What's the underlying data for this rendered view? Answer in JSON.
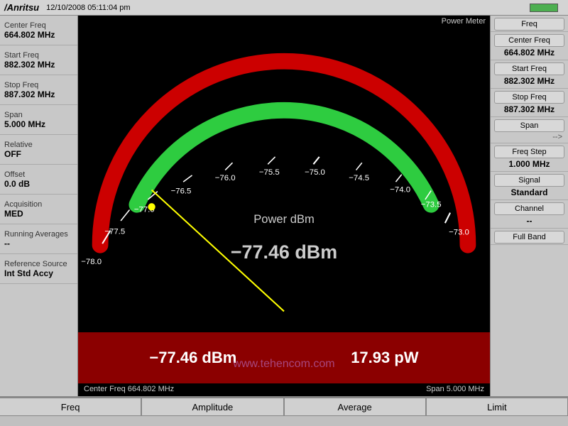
{
  "topbar": {
    "logo": "/Anritsu",
    "datetime": "12/10/2008  05:11:04 pm"
  },
  "left": {
    "items": [
      {
        "label": "Center Freq",
        "value": "664.802 MHz"
      },
      {
        "label": "Start Freq",
        "value": "882.302 MHz"
      },
      {
        "label": "Stop Freq",
        "value": "887.302 MHz"
      },
      {
        "label": "Span",
        "value": "5.000 MHz"
      },
      {
        "label": "Relative",
        "value": "OFF"
      },
      {
        "label": "Offset",
        "value": "0.0 dB"
      },
      {
        "label": "Acquisition",
        "value": "MED"
      },
      {
        "label": "Running Averages",
        "value": "--"
      },
      {
        "label": "Reference Source",
        "value": "Int Std Accy"
      }
    ]
  },
  "display": {
    "power_meter_label": "Power Meter",
    "power_dbm_label": "Power dBm",
    "main_value": "−77.46 dBm",
    "bottom_left": "−77.46 dBm",
    "bottom_right": "17.93 pW",
    "watermark": "www.tehencom.com",
    "status_left": "Center Freq 664.802 MHz",
    "status_right": "Span 5.000 MHz",
    "gauge": {
      "ticks": [
        "-78.0",
        "-77.5",
        "-77.0",
        "-76.5",
        "-76.0",
        "-75.5",
        "-75.0",
        "-74.5",
        "-74.0",
        "-73.5",
        "-73.0"
      ]
    }
  },
  "right": {
    "groups": [
      {
        "btn": "Freq"
      },
      {
        "btn": "Center Freq",
        "val": "664.802 MHz"
      },
      {
        "btn": "Start Freq",
        "val": "882.302 MHz"
      },
      {
        "btn": "Stop Freq",
        "val": "887.302 MHz"
      },
      {
        "btn": "Span",
        "arrow": "-->"
      },
      {
        "btn": "Freq Step",
        "val": "1.000 MHz"
      },
      {
        "btn": "Signal",
        "val": "Standard"
      },
      {
        "btn": "Channel",
        "val": "--"
      },
      {
        "btn": "Full Band"
      }
    ]
  },
  "bottom_tabs": [
    "Freq",
    "Amplitude",
    "Average",
    "Limit"
  ]
}
